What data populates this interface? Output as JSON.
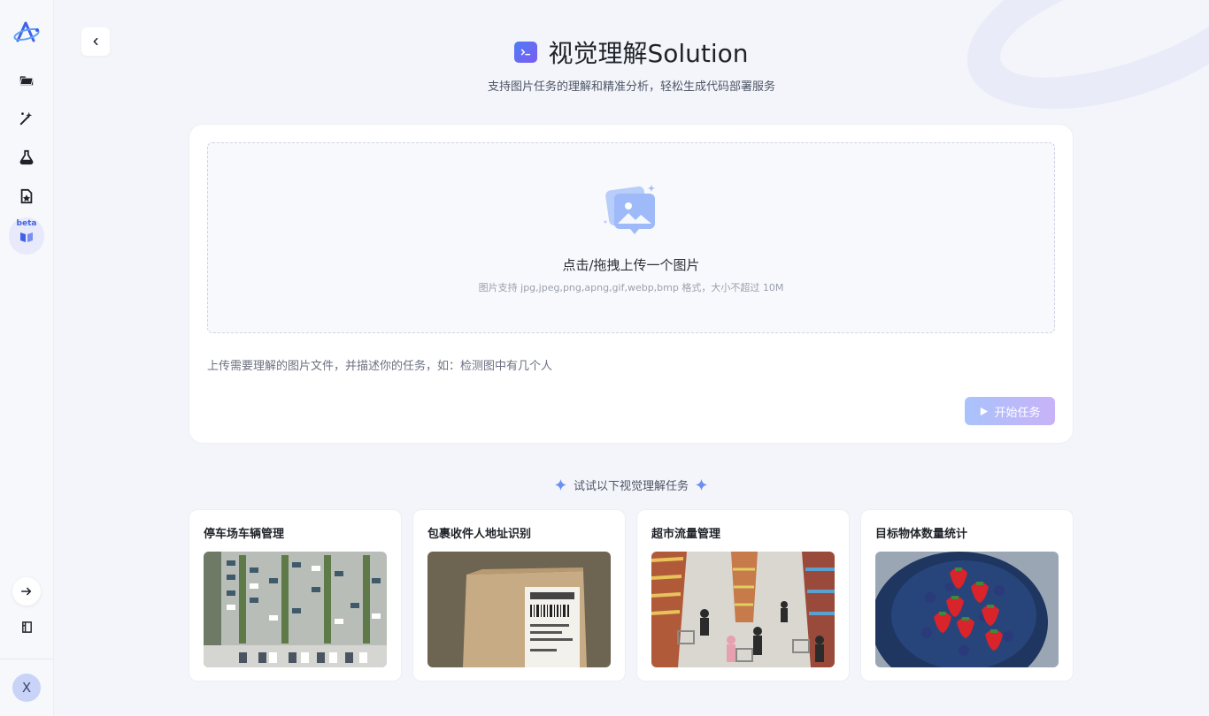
{
  "sidebar": {
    "logo": "app-logo",
    "items": [
      {
        "name": "folder-icon"
      },
      {
        "name": "magic-icon"
      },
      {
        "name": "flask-icon"
      },
      {
        "name": "star-file-icon"
      }
    ],
    "beta_label": "beta",
    "beta_icon": "book-open-icon",
    "expand_icon": "arrow-right-icon",
    "docs_icon": "book-icon",
    "avatar_letter": "X"
  },
  "header": {
    "title": "视觉理解Solution",
    "subtitle": "支持图片任务的理解和精准分析，轻松生成代码部署服务"
  },
  "upload": {
    "title": "点击/拖拽上传一个图片",
    "hint": "图片支持 jpg,jpeg,png,apng,gif,webp,bmp 格式，大小不超过 10M"
  },
  "task": {
    "placeholder": "上传需要理解的图片文件，并描述你的任务，如：检测图中有几个人",
    "value": ""
  },
  "start_button": "开始任务",
  "try_section": {
    "heading": "试试以下视觉理解任务",
    "samples": [
      {
        "title": "停车场车辆管理",
        "image": "parking-lot-photo"
      },
      {
        "title": "包裹收件人地址识别",
        "image": "package-label-photo"
      },
      {
        "title": "超市流量管理",
        "image": "supermarket-photo"
      },
      {
        "title": "目标物体数量统计",
        "image": "strawberries-photo"
      }
    ]
  },
  "colors": {
    "accent": "#3f62e8",
    "button_gradient_start": "#a9c3fb",
    "button_gradient_end": "#c8b2f8",
    "background": "#f3f5fa"
  }
}
